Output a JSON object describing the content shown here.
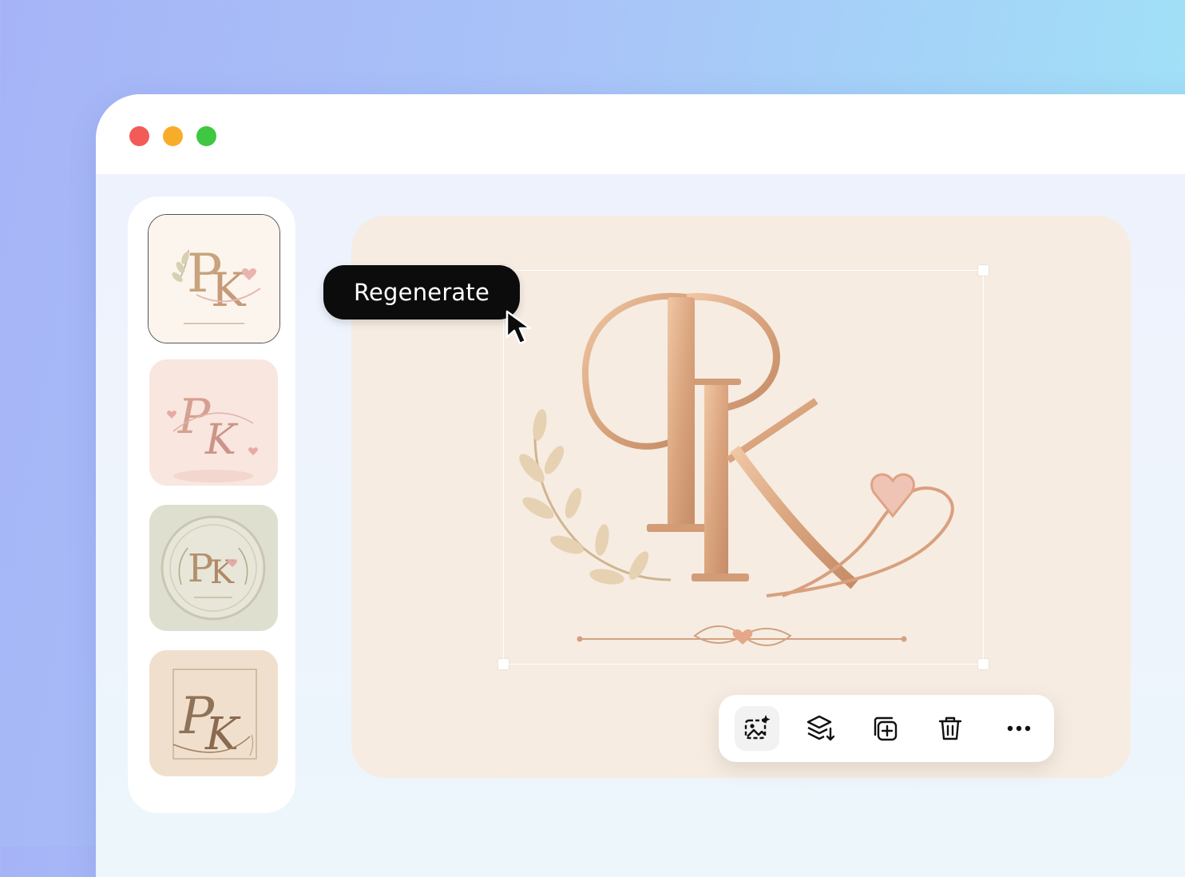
{
  "window": {
    "traffic_lights": [
      "close",
      "minimize",
      "maximize"
    ],
    "colors": {
      "close": "#f25b57",
      "minimize": "#f7ad2a",
      "maximize": "#3fc741"
    }
  },
  "sidebar": {
    "thumbnails": [
      {
        "name": "thumbnail-1",
        "monogram": "PK",
        "style": "rose-gold-heart",
        "selected": true
      },
      {
        "name": "thumbnail-2",
        "monogram": "PK",
        "style": "pink-script",
        "selected": false
      },
      {
        "name": "thumbnail-3",
        "monogram": "PK",
        "style": "sage-laurel-seal",
        "selected": false
      },
      {
        "name": "thumbnail-4",
        "monogram": "PK",
        "style": "beige-frame-script",
        "selected": false
      }
    ]
  },
  "canvas": {
    "monogram": "PK",
    "background": "#f6ece2",
    "accent": "#d9a47e"
  },
  "tooltip": {
    "label": "Regenerate"
  },
  "toolbar": {
    "buttons": [
      {
        "icon": "ai-image-icon",
        "active": true
      },
      {
        "icon": "layers-arrange-icon",
        "active": false
      },
      {
        "icon": "duplicate-icon",
        "active": false
      },
      {
        "icon": "trash-icon",
        "active": false
      },
      {
        "icon": "more-icon",
        "active": false
      }
    ]
  }
}
